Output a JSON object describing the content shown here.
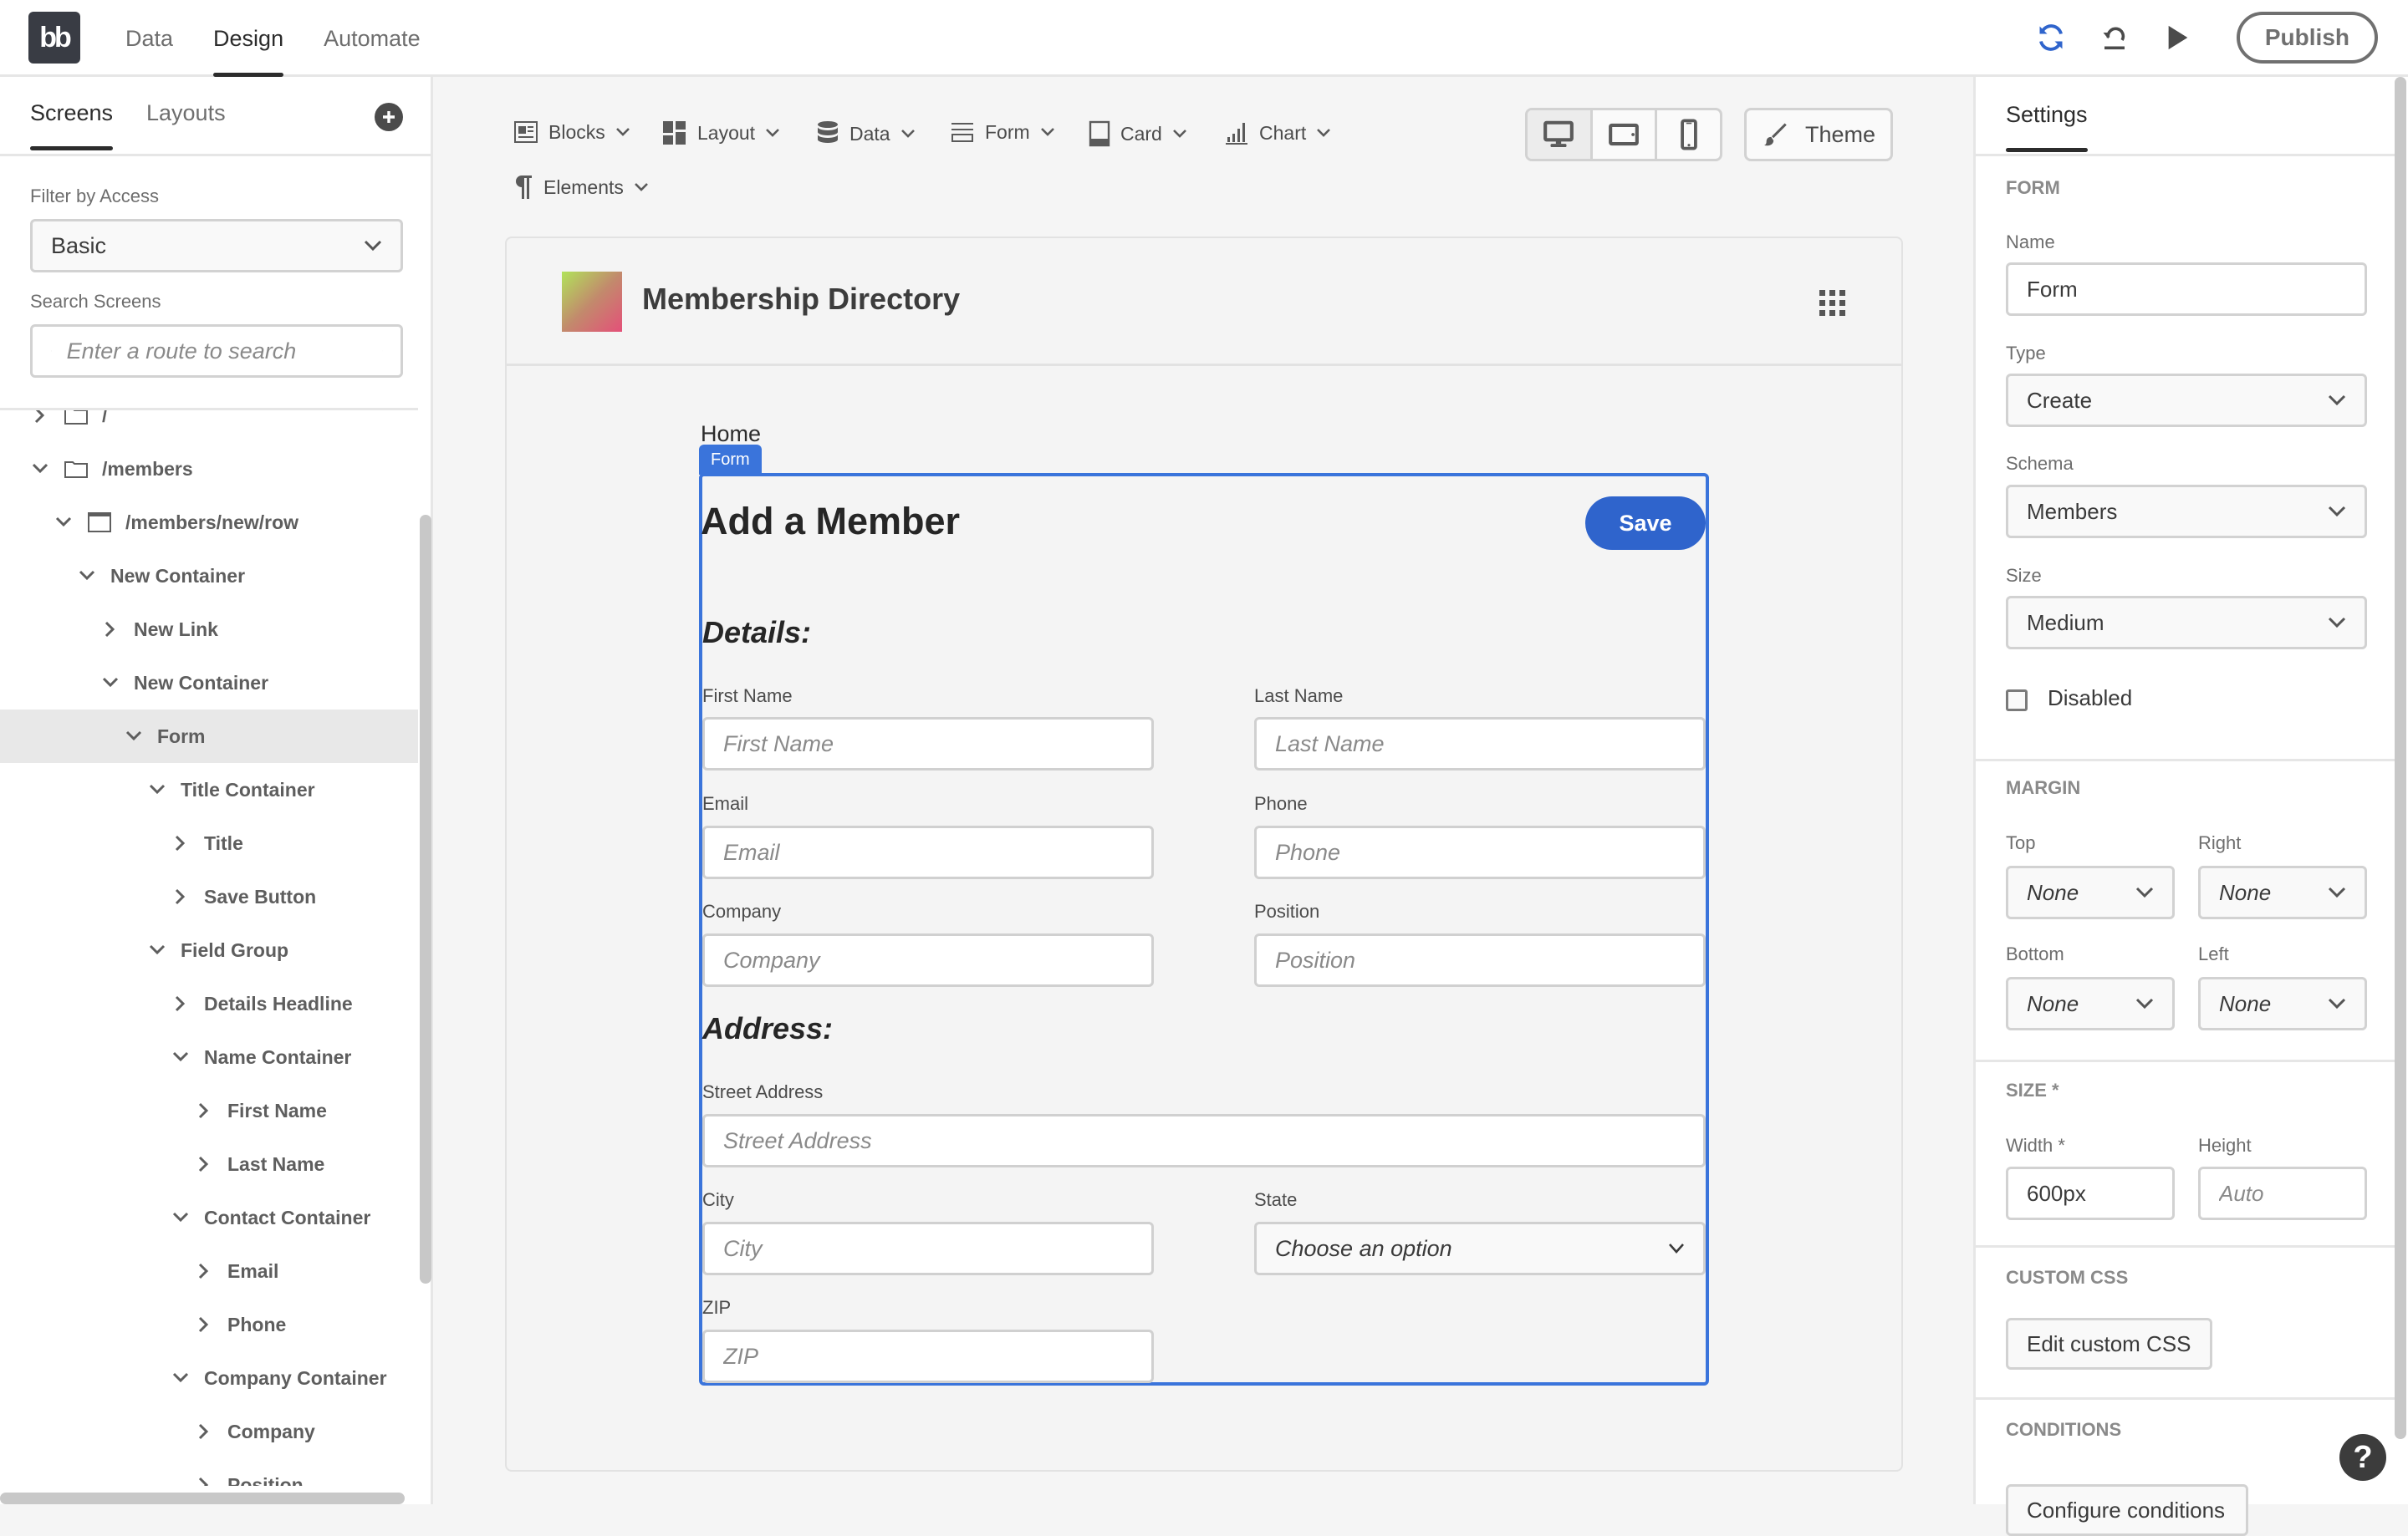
{
  "topbar": {
    "logo_text": "bb",
    "tabs": [
      {
        "label": "Data",
        "active": false
      },
      {
        "label": "Design",
        "active": true
      },
      {
        "label": "Automate",
        "active": false
      }
    ],
    "actions": {
      "refresh_icon": "refresh-icon",
      "undo_icon": "undo-icon",
      "preview_icon": "play-icon",
      "publish_label": "Publish"
    },
    "accent_color": "#2f64cc"
  },
  "left_panel": {
    "tabs": [
      {
        "label": "Screens",
        "active": true
      },
      {
        "label": "Layouts",
        "active": false
      }
    ],
    "filter_label": "Filter by Access",
    "filter_value": "Basic",
    "search_label": "Search Screens",
    "search_placeholder": "Enter a route to search",
    "tree": [
      {
        "label": "/",
        "depth": 0,
        "icon": "folder",
        "expanded": false
      },
      {
        "label": "/members",
        "depth": 0,
        "icon": "folder",
        "expanded": true
      },
      {
        "label": "/members/new/row",
        "depth": 1,
        "icon": "screen",
        "expanded": true
      },
      {
        "label": "New Container",
        "depth": 2,
        "expanded": true
      },
      {
        "label": "New Link",
        "depth": 3,
        "expanded": false
      },
      {
        "label": "New Container",
        "depth": 3,
        "expanded": true
      },
      {
        "label": "Form",
        "depth": 4,
        "expanded": true,
        "selected": true
      },
      {
        "label": "Title Container",
        "depth": 5,
        "expanded": true
      },
      {
        "label": "Title",
        "depth": 6,
        "expanded": false
      },
      {
        "label": "Save Button",
        "depth": 6,
        "expanded": false
      },
      {
        "label": "Field Group",
        "depth": 5,
        "expanded": true
      },
      {
        "label": "Details Headline",
        "depth": 6,
        "expanded": false
      },
      {
        "label": "Name Container",
        "depth": 6,
        "expanded": true
      },
      {
        "label": "First Name",
        "depth": 7,
        "expanded": false
      },
      {
        "label": "Last Name",
        "depth": 7,
        "expanded": false
      },
      {
        "label": "Contact Container",
        "depth": 6,
        "expanded": true
      },
      {
        "label": "Email",
        "depth": 7,
        "expanded": false
      },
      {
        "label": "Phone",
        "depth": 7,
        "expanded": false
      },
      {
        "label": "Company Container",
        "depth": 6,
        "expanded": true
      },
      {
        "label": "Company",
        "depth": 7,
        "expanded": false
      },
      {
        "label": "Position",
        "depth": 7,
        "expanded": false
      }
    ]
  },
  "toolbar": {
    "items": [
      {
        "label": "Blocks",
        "icon": "blocks-icon"
      },
      {
        "label": "Layout",
        "icon": "layout-icon"
      },
      {
        "label": "Data",
        "icon": "database-icon"
      },
      {
        "label": "Form",
        "icon": "form-icon"
      },
      {
        "label": "Card",
        "icon": "card-icon"
      },
      {
        "label": "Chart",
        "icon": "chart-icon"
      },
      {
        "label": "Elements",
        "icon": "paragraph-icon"
      }
    ],
    "devices": [
      {
        "name": "desktop",
        "active": true
      },
      {
        "name": "tablet",
        "active": false
      },
      {
        "name": "mobile",
        "active": false
      }
    ],
    "theme_label": "Theme"
  },
  "preview": {
    "app_title": "Membership Directory",
    "home_link": "Home",
    "selected_tag": "Form",
    "form_title": "Add a Member",
    "save_label": "Save",
    "details_heading": "Details:",
    "address_heading": "Address:",
    "fields": {
      "first_name": {
        "label": "First Name",
        "placeholder": "First Name"
      },
      "last_name": {
        "label": "Last Name",
        "placeholder": "Last Name"
      },
      "email": {
        "label": "Email",
        "placeholder": "Email"
      },
      "phone": {
        "label": "Phone",
        "placeholder": "Phone"
      },
      "company": {
        "label": "Company",
        "placeholder": "Company"
      },
      "position": {
        "label": "Position",
        "placeholder": "Position"
      },
      "street": {
        "label": "Street Address",
        "placeholder": "Street Address"
      },
      "city": {
        "label": "City",
        "placeholder": "City"
      },
      "state": {
        "label": "State",
        "value": "Choose an option"
      },
      "zip": {
        "label": "ZIP",
        "placeholder": "ZIP"
      }
    },
    "selection_color": "#3a74db"
  },
  "settings": {
    "tab_label": "Settings",
    "form_section": "FORM",
    "name_label": "Name",
    "name_value": "Form",
    "type_label": "Type",
    "type_value": "Create",
    "schema_label": "Schema",
    "schema_value": "Members",
    "size_label": "Size",
    "size_value": "Medium",
    "disabled_label": "Disabled",
    "disabled_checked": false,
    "margin_section": "MARGIN",
    "margin": {
      "top_label": "Top",
      "top_value": "None",
      "right_label": "Right",
      "right_value": "None",
      "bottom_label": "Bottom",
      "bottom_value": "None",
      "left_label": "Left",
      "left_value": "None"
    },
    "size_section": "SIZE *",
    "width_label": "Width *",
    "width_value": "600px",
    "height_label": "Height",
    "height_placeholder": "Auto",
    "css_section": "CUSTOM CSS",
    "css_button": "Edit custom CSS",
    "conditions_section": "CONDITIONS",
    "conditions_button": "Configure conditions",
    "help_label": "?"
  }
}
